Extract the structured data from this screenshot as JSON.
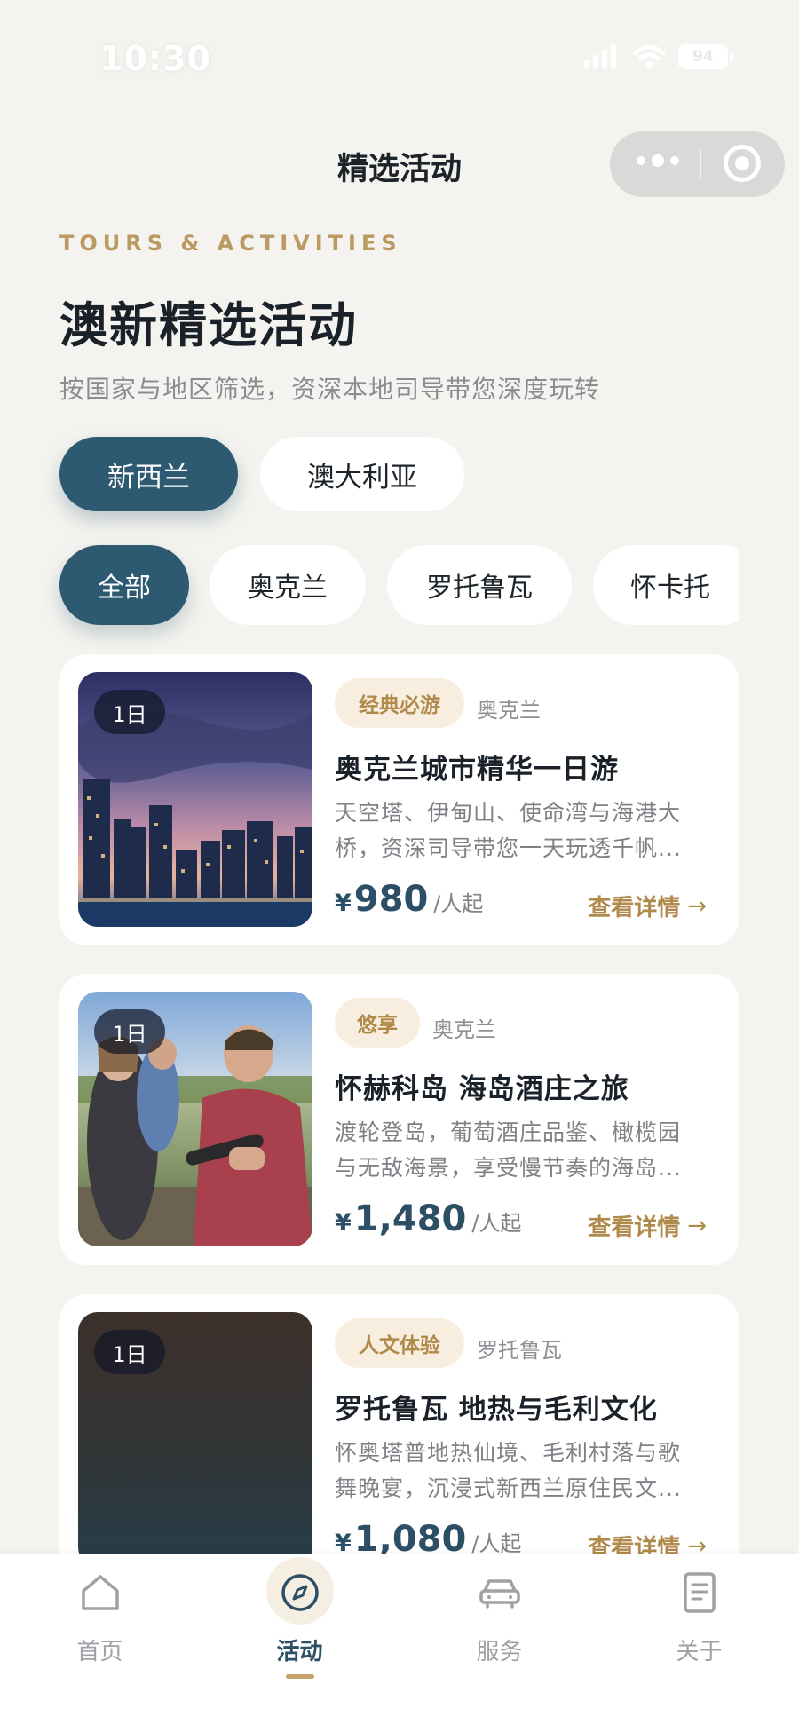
{
  "status_bar": {
    "time": "10:30",
    "battery": "94"
  },
  "nav": {
    "title": "精选活动"
  },
  "header": {
    "eyebrow": "TOURS & ACTIVITIES",
    "title": "澳新精选活动",
    "subtitle": "按国家与地区筛选，资深本地司导带您深度玩转"
  },
  "country_tabs": [
    {
      "label": "新西兰",
      "active": true
    },
    {
      "label": "澳大利亚",
      "active": false
    }
  ],
  "region_chips": [
    {
      "label": "全部",
      "active": true
    },
    {
      "label": "奥克兰",
      "active": false
    },
    {
      "label": "罗托鲁瓦",
      "active": false
    },
    {
      "label": "怀卡托",
      "active": false
    }
  ],
  "cards": [
    {
      "duration": "1日",
      "tag": "经典必游",
      "region": "奥克兰",
      "title": "奥克兰城市精华一日游",
      "desc_line1": "天空塔、伊甸山、使命湾与海港大",
      "desc_line2": "桥，资深司导带您一天玩透千帆...",
      "currency": "¥",
      "price": "980",
      "price_unit": "/人起",
      "detail": "查看详情",
      "image": "auckland-skyline-photo"
    },
    {
      "duration": "1日",
      "tag": "悠享",
      "region": "奥克兰",
      "title": "怀赫科岛 海岛酒庄之旅",
      "desc_line1": "渡轮登岛，葡萄酒庄品鉴、橄榄园",
      "desc_line2": "与无敌海景，享受慢节奏的海岛...",
      "currency": "¥",
      "price": "1,480",
      "price_unit": "/人起",
      "detail": "查看详情",
      "image": "winery-tasting-photo"
    },
    {
      "duration": "1日",
      "tag": "人文体验",
      "region": "罗托鲁瓦",
      "title": "罗托鲁瓦 地热与毛利文化",
      "desc_line1": "怀奥塔普地热仙境、毛利村落与歌",
      "desc_line2": "舞晚宴，沉浸式新西兰原住民文...",
      "currency": "¥",
      "price": "1,080",
      "price_unit": "/人起",
      "detail": "查看详情",
      "image": "placeholder-gradient"
    }
  ],
  "tab_bar": [
    {
      "label": "首页",
      "icon": "home-icon",
      "active": false
    },
    {
      "label": "活动",
      "icon": "compass-icon",
      "active": true
    },
    {
      "label": "服务",
      "icon": "car-icon",
      "active": false
    },
    {
      "label": "关于",
      "icon": "document-icon",
      "active": false
    }
  ],
  "colors": {
    "background": "#f4f3ef",
    "primary": "#2e5a71",
    "accent_gold": "#b08a4a",
    "tag_bg": "#f7eedf"
  }
}
